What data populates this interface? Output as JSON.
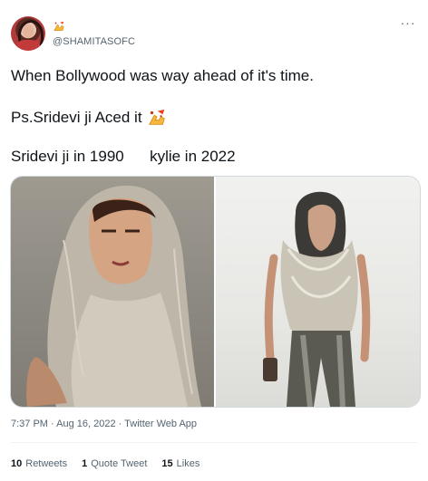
{
  "author": {
    "handle": "@SHAMITASOFC",
    "avatar_icon": "profile-photo-avatar",
    "name_sticker_icon": "flexed-arm-sticker-icon"
  },
  "menu": {
    "more_label": "···"
  },
  "tweet": {
    "line1": "When Bollywood was way ahead of it's time.",
    "line2": "Ps.Sridevi ji Aced it",
    "line2_sticker_icon": "flexed-arm-sticker-icon",
    "line3": "Sridevi ji in 1990      kylie in 2022"
  },
  "media": {
    "photos": [
      {
        "subject": "woman in silver chainmail hood"
      },
      {
        "subject": "woman in silver chainmail hood top and jeans"
      }
    ]
  },
  "meta": {
    "timestamp": "7:37 PM · Aug 16, 2022 · Twitter Web App"
  },
  "stats": {
    "retweets_count": "10",
    "retweets_label": "Retweets",
    "quotes_count": "1",
    "quotes_label": "Quote Tweet",
    "likes_count": "15",
    "likes_label": "Likes"
  },
  "colors": {
    "text_primary": "#0f1419",
    "text_secondary": "#536471",
    "border": "#cfd9de",
    "divider": "#eff3f4"
  }
}
